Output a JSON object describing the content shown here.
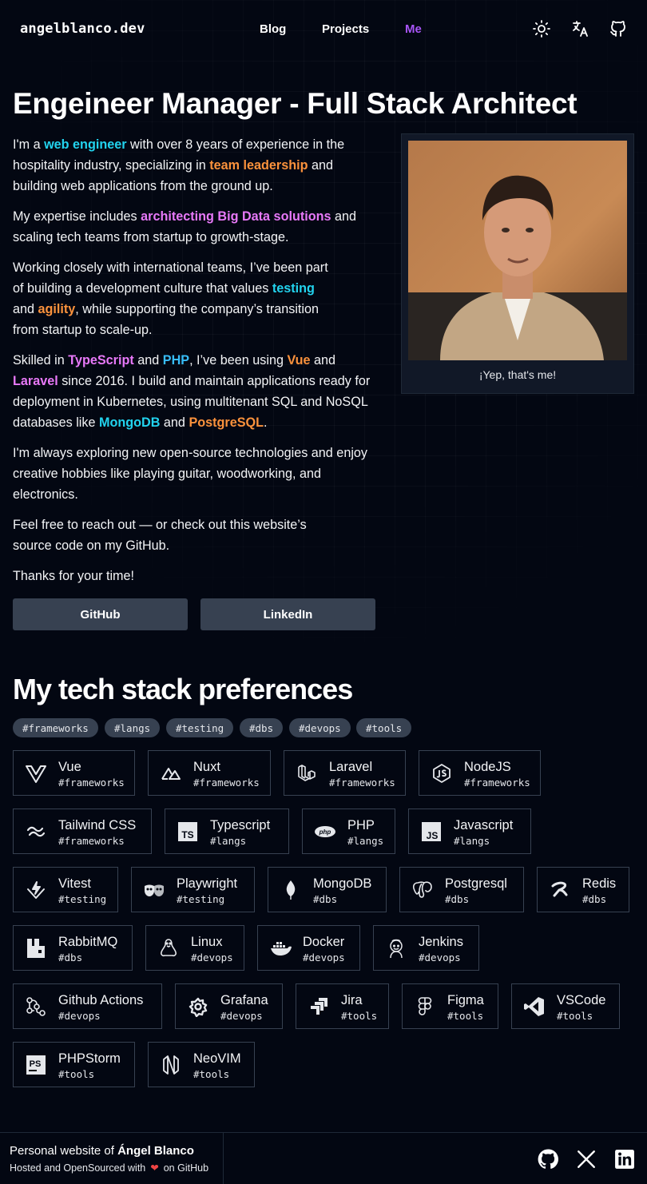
{
  "header": {
    "logo": "angelblanco.dev",
    "nav": [
      "Blog",
      "Projects",
      "Me"
    ],
    "active_nav": "Me",
    "icons": [
      "sun-icon",
      "translate-icon",
      "github-icon"
    ]
  },
  "hero": {
    "title": "Engeineer Manager - Full Stack Architect",
    "p1": {
      "a": "I'm a ",
      "h1": "web engineer",
      "b": " with over 8 years of experience in the hospitality industry, specializing in ",
      "h2": "team leadership",
      "c": " and building web applications from the ground up."
    },
    "p2": {
      "a": "My expertise includes ",
      "h1": "architecting Big Data solutions",
      "b": " and scaling tech teams from startup to growth-stage."
    },
    "p3": {
      "a": "Working closely with international teams, I’ve been part of building a development culture that values ",
      "h1": "testing",
      "b": " and ",
      "h2": "agility",
      "c": ", while supporting the company’s transition from startup to scale-up."
    },
    "p4": {
      "a": "Skilled in ",
      "h1": "TypeScript",
      "b": " and ",
      "h2": "PHP",
      "c": ", I’ve been using ",
      "h3": "Vue",
      "d": " and ",
      "h4": "Laravel",
      "e": " since 2016. I build and maintain applications ready for deployment in Kubernetes, using multitenant SQL and NoSQL databases like ",
      "h5": "MongoDB",
      "f": " and ",
      "h6": "PostgreSQL",
      "g": "."
    },
    "p5": "I'm always exploring new open-source technologies and enjoy creative hobbies like playing guitar, woodworking, and electronics.",
    "p6": "Feel free to reach out — or check out this website’s source code on my GitHub.",
    "p7": "Thanks for your time!",
    "photo_caption": "¡Yep, that's me!",
    "buttons": [
      "GitHub",
      "LinkedIn"
    ]
  },
  "stack": {
    "title": "My tech stack preferences",
    "tags": [
      "#frameworks",
      "#langs",
      "#testing",
      "#dbs",
      "#devops",
      "#tools"
    ],
    "items": [
      {
        "name": "Vue",
        "tag": "#frameworks",
        "icon": "vue-icon"
      },
      {
        "name": "Nuxt",
        "tag": "#frameworks",
        "icon": "nuxt-icon"
      },
      {
        "name": "Laravel",
        "tag": "#frameworks",
        "icon": "laravel-icon"
      },
      {
        "name": "NodeJS",
        "tag": "#frameworks",
        "icon": "nodejs-icon"
      },
      {
        "name": "Tailwind CSS",
        "tag": "#frameworks",
        "icon": "tailwind-icon"
      },
      {
        "name": "Typescript",
        "tag": "#langs",
        "icon": "typescript-icon"
      },
      {
        "name": "PHP",
        "tag": "#langs",
        "icon": "php-icon"
      },
      {
        "name": "Javascript",
        "tag": "#langs",
        "icon": "javascript-icon"
      },
      {
        "name": "Vitest",
        "tag": "#testing",
        "icon": "vitest-icon"
      },
      {
        "name": "Playwright",
        "tag": "#testing",
        "icon": "playwright-icon"
      },
      {
        "name": "MongoDB",
        "tag": "#dbs",
        "icon": "mongodb-icon"
      },
      {
        "name": "Postgresql",
        "tag": "#dbs",
        "icon": "postgresql-icon"
      },
      {
        "name": "Redis",
        "tag": "#dbs",
        "icon": "redis-icon"
      },
      {
        "name": "RabbitMQ",
        "tag": "#dbs",
        "icon": "rabbitmq-icon"
      },
      {
        "name": "Linux",
        "tag": "#devops",
        "icon": "linux-icon"
      },
      {
        "name": "Docker",
        "tag": "#devops",
        "icon": "docker-icon"
      },
      {
        "name": "Jenkins",
        "tag": "#devops",
        "icon": "jenkins-icon"
      },
      {
        "name": "Github Actions",
        "tag": "#devops",
        "icon": "github-actions-icon"
      },
      {
        "name": "Grafana",
        "tag": "#devops",
        "icon": "grafana-icon"
      },
      {
        "name": "Jira",
        "tag": "#tools",
        "icon": "jira-icon"
      },
      {
        "name": "Figma",
        "tag": "#tools",
        "icon": "figma-icon"
      },
      {
        "name": "VSCode",
        "tag": "#tools",
        "icon": "vscode-icon"
      },
      {
        "name": "PHPStorm",
        "tag": "#tools",
        "icon": "phpstorm-icon"
      },
      {
        "name": "NeoVIM",
        "tag": "#tools",
        "icon": "neovim-icon"
      }
    ]
  },
  "footer": {
    "line1_prefix": "Personal website of ",
    "line1_name": "Ángel Blanco",
    "line2_prefix": "Hosted and OpenSourced with",
    "line2_suffix": "on GitHub",
    "icons": [
      "github-icon",
      "x-icon",
      "linkedin-icon"
    ]
  },
  "colors": {
    "background": "#030712",
    "accent_nav": "#a855f7",
    "cyan": "#22d3ee",
    "orange": "#fb923c",
    "pink": "#e879f9",
    "sky": "#38bdf8",
    "button": "#374151"
  }
}
